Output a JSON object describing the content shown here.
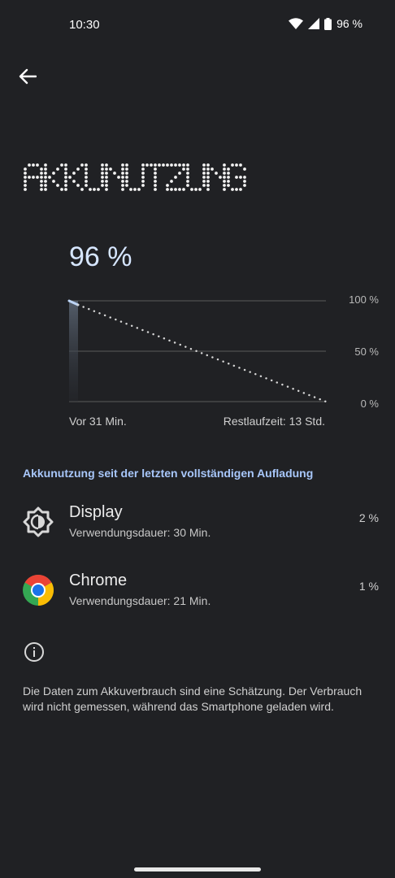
{
  "status_bar": {
    "time": "10:30",
    "battery": "96 %"
  },
  "header": {
    "title": "AKKUNUTZUNG"
  },
  "battery_level": "96 %",
  "chart": {
    "y_ticks": [
      "100 %",
      "50 %",
      "0 %"
    ],
    "left_caption": "Vor 31 Min.",
    "right_caption": "Restlaufzeit: 13 Std."
  },
  "chart_data": {
    "type": "line",
    "title": "",
    "xlabel": "",
    "ylabel": "",
    "ylim": [
      0,
      100
    ],
    "y_tick_labels": [
      "100 %",
      "50 %",
      "0 %"
    ],
    "x_tick_labels": [
      "Vor 31 Min.",
      "Restlaufzeit: 13 Std."
    ],
    "series": [
      {
        "values": [
          100,
          96
        ]
      },
      {
        "values": [
          96,
          0
        ]
      }
    ],
    "grid": true
  },
  "section": {
    "header": "Akkunutzung seit der letzten vollständigen Aufladung"
  },
  "items": [
    {
      "name": "Display",
      "sub": "Verwendungsdauer: 30 Min.",
      "percent": "2 %",
      "icon": "display-brightness-icon"
    },
    {
      "name": "Chrome",
      "sub": "Verwendungsdauer: 21 Min.",
      "percent": "1 %",
      "icon": "chrome-icon"
    }
  ],
  "footer": {
    "info_text": "Die Daten zum Akkuverbrauch sind eine Schätzung. Der Verbrauch wird nicht gemessen, während das Smartphone geladen wird."
  },
  "colors": {
    "background": "#202124",
    "accent": "#a8c7fa",
    "level": "#d6e6ff"
  }
}
